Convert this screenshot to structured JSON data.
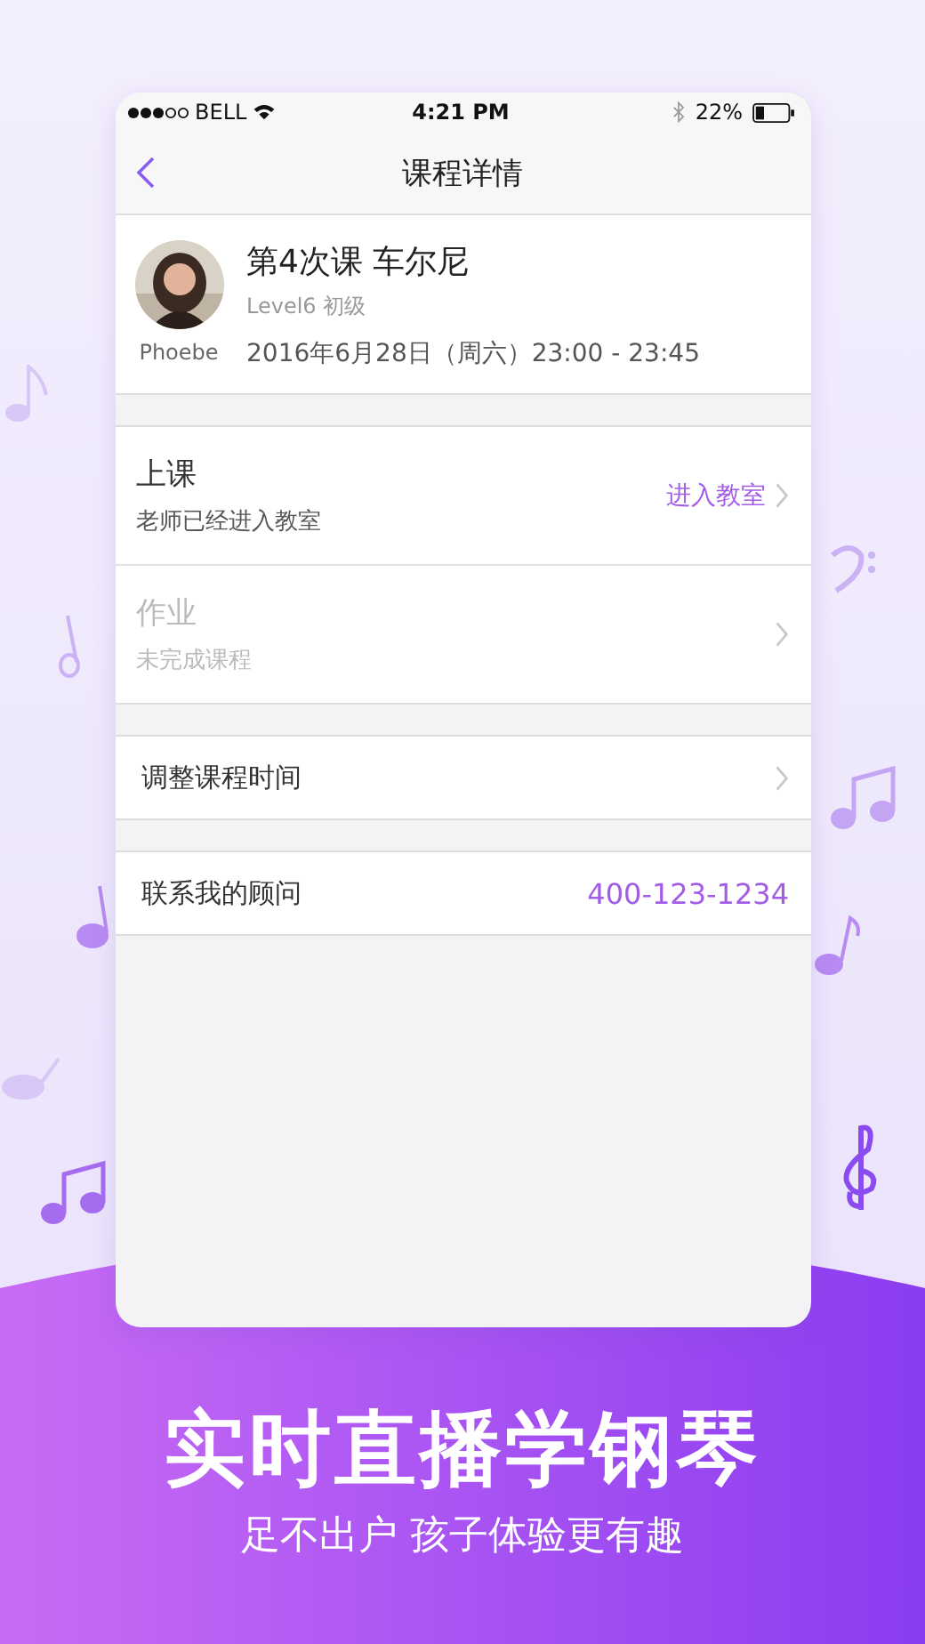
{
  "status_bar": {
    "carrier": "BELL",
    "time": "4:21 PM",
    "battery": "22%"
  },
  "nav": {
    "title": "课程详情"
  },
  "lesson": {
    "title": "第4次课 车尔尼",
    "level": "Level6 初级",
    "teacher": "Phoebe",
    "time": "2016年6月28日（周六）23:00 - 23:45"
  },
  "sections": [
    [
      {
        "kind": "task",
        "title": "上课",
        "subtitle": "老师已经进入教室",
        "action": "进入教室",
        "disabled": false
      },
      {
        "kind": "task",
        "title": "作业",
        "subtitle": "未完成课程",
        "disabled": true
      }
    ],
    [
      {
        "kind": "link",
        "label": "调整课程时间"
      }
    ],
    [
      {
        "kind": "contact",
        "label": "联系我的顾问",
        "value": "400-123-1234"
      }
    ]
  ],
  "banner": {
    "headline": "实时直播学钢琴",
    "tagline": "足不出户 孩子体验更有趣"
  }
}
